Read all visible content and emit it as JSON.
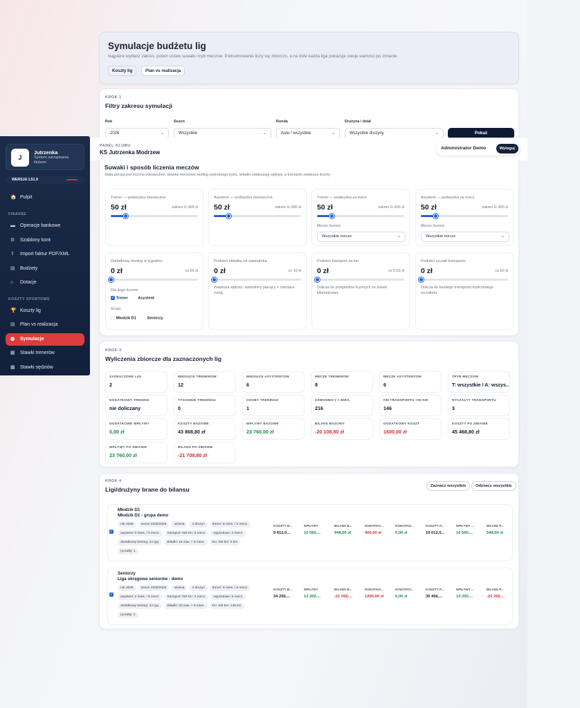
{
  "header": {
    "title": "Symulacje budżetu lig",
    "subtitle": "Najpierw wybierz zakres, potem ustaw suwaki i tryb meczów. Podsumowanie liczy się zbiorczo, a na dole każda liga pokazuje swoje wartości po zmianie.",
    "tabs": [
      "Koszty lig",
      "Plan vs realizacja"
    ]
  },
  "step1": {
    "kicker": "KROK 1",
    "title": "Filtry zakresu symulacji",
    "filters": [
      {
        "label": "Rok",
        "value": "2026"
      },
      {
        "label": "Sezon",
        "value": "Wszystkie"
      },
      {
        "label": "Runda",
        "value": "Auto / wszystkie"
      },
      {
        "label": "Drużyna / dział",
        "value": "Wszystkie drużyny"
      }
    ],
    "show_button": "Pokaż"
  },
  "topbar": {
    "kicker": "PANEL KLUBU",
    "club": "KS Jutrzenka Modrzew",
    "user": "Administrator Demo",
    "logout": "Wyloguj"
  },
  "sidebar": {
    "logo_letter": "J",
    "app_name": "Jutrzenka",
    "app_desc": "System zarządzania klubem",
    "version": "WERSJA 1.51.9",
    "items_top": [
      {
        "label": "Pulpit",
        "icon": "🏠"
      }
    ],
    "section_finance": "FINANSE",
    "finance": [
      {
        "label": "Operacje bankowe",
        "icon": "▬"
      },
      {
        "label": "Szablony kont",
        "icon": "⚙"
      },
      {
        "label": "Import faktur PDF/XML",
        "icon": "⇪"
      },
      {
        "label": "Budżety",
        "icon": "▤"
      },
      {
        "label": "Dotacje",
        "icon": "⌂"
      }
    ],
    "section_sport": "KOSZTY SPORTOWE",
    "sport": [
      {
        "label": "Koszty lig",
        "icon": "🏆"
      },
      {
        "label": "Plan vs realizacja",
        "icon": "▤"
      },
      {
        "label": "Symulacje",
        "icon": "◍"
      },
      {
        "label": "Stawki trenerów",
        "icon": "▦"
      },
      {
        "label": "Stawki sędziów",
        "icon": "▩"
      }
    ]
  },
  "step2": {
    "title": "Suwaki i sposób liczenia meczów",
    "subtitle": "Stała pensja jest liczona miesięcznie, stawka meczowa według wybranego trybu, składki zwiększają wpływy, a transport zwiększa koszty.",
    "sliders": [
      {
        "label": "Trener — podwyżka miesięczna",
        "value": "50 zł",
        "range": "zakres 0–300 zł",
        "level": 0.1667
      },
      {
        "label": "Asystent — podwyżka miesięczna",
        "value": "50 zł",
        "range": "zakres 0–300 zł",
        "level": 0.1667
      },
      {
        "label": "Trener — podwyżka za mecz",
        "value": "50 zł",
        "range": "zakres 0–300 zł",
        "level": 0.1667,
        "select_label": "Mecze liczone",
        "select_value": "Wszystkie mecze"
      },
      {
        "label": "Asystent — podwyżka za mecz",
        "value": "50 zł",
        "range": "zakres 0–300 zł",
        "level": 0.1667,
        "select_label": "Mecze liczone",
        "select_value": "Wszystkie mecze"
      },
      {
        "label": "Dodatkowy trening w tygodniu",
        "value": "0 zł",
        "range": "co 50 zł",
        "level": 0
      },
      {
        "label": "Podnieś składkę od zawodnika",
        "value": "0 zł",
        "range": "co 10 zł",
        "level": 0,
        "hint": "Zwiększa wpływy: zawodnicy płacący × miesiące rundy."
      },
      {
        "label": "Podnieś transport za km",
        "value": "0 zł",
        "range": "co 0,50 zł",
        "level": 0,
        "hint": "Dolicza do przejazdów liczonych ze stawki kilometrowej."
      },
      {
        "label": "Podnieś ryczałt transportu",
        "value": "0 zł",
        "range": "co 50 zł",
        "level": 0,
        "hint": "Dolicza do każdego transportu rozliczanego ryczałtem."
      }
    ],
    "for_whom_label": "Dla kogo liczone",
    "for_whom": [
      {
        "label": "Trener",
        "checked": true
      },
      {
        "label": "Asystent",
        "checked": false
      }
    ],
    "groups_label": "Grupy",
    "groups": [
      {
        "label": "Młodzik D1",
        "checked": false
      },
      {
        "label": "Seniorzy",
        "checked": false
      }
    ]
  },
  "step3": {
    "kicker": "KROK 3",
    "title": "Wyliczenia zbiorcze dla zaznaczonych lig",
    "metrics": [
      {
        "label": "ZAZNACZONE LIGI",
        "value": "2",
        "tone": ""
      },
      {
        "label": "MIESIĄCE TRENERÓW",
        "value": "12",
        "tone": ""
      },
      {
        "label": "MIESIĄCE ASYSTENTÓW",
        "value": "6",
        "tone": ""
      },
      {
        "label": "MECZE TRENERÓW",
        "value": "8",
        "tone": ""
      },
      {
        "label": "MECZE ASYSTENTÓW",
        "value": "6",
        "tone": ""
      },
      {
        "label": "TRYB MECZÓW",
        "value": "T: wszystkie / A: wszys...",
        "tone": ""
      },
      {
        "label": "DODATKOWY TRENING",
        "value": "nie doliczany",
        "tone": ""
      },
      {
        "label": "TYGODNIE TRENINGU",
        "value": "0",
        "tone": ""
      },
      {
        "label": "OSOBY TRENINGU",
        "value": "1",
        "tone": ""
      },
      {
        "label": "ZAWODNICY × MIES.",
        "value": "216",
        "tone": ""
      },
      {
        "label": "KM TRANSPORTU >50 KM",
        "value": "146",
        "tone": ""
      },
      {
        "label": "RYCZAŁTY TRANSPORTU",
        "value": "3",
        "tone": ""
      },
      {
        "label": "DODATKOWE WPŁYWY",
        "value": "0,00 zł",
        "tone": "green"
      },
      {
        "label": "KOSZTY BAZOWE",
        "value": "43 868,80 zł",
        "tone": ""
      },
      {
        "label": "WPŁYWY BAZOWE",
        "value": "23 760,00 zł",
        "tone": "green"
      },
      {
        "label": "BILANS BAZOWY",
        "value": "-20 108,80 zł",
        "tone": "red"
      },
      {
        "label": "DODATKOWY KOSZT",
        "value": "1600,00 zł",
        "tone": "red"
      },
      {
        "label": "KOSZTY PO ZMIANIE",
        "value": "45 468,80 zł",
        "tone": ""
      },
      {
        "label": "WPŁYWY PO ZMIANIE",
        "value": "23 760,00 zł",
        "tone": "green"
      },
      {
        "label": "BILANS PO ZMIANIE",
        "value": "-21 708,80 zł",
        "tone": "red"
      }
    ]
  },
  "step4": {
    "kicker": "KROK 4",
    "title": "Ligi/drużyny brane do bilansu",
    "select_all": "Zaznacz wszystkie",
    "deselect_all": "Odznacz wszystkie",
    "leagues": [
      {
        "team": "Młodzik D1",
        "league": "Młodzik D1 - grupa demo",
        "tags": [
          [
            "rok 2026",
            "sezon 2025/2026",
            "wiosna",
            "3 drużyn",
            "trener: 6 mies. / 2 mecz."
          ],
          [
            "asystent: 0 mies. / 0 mecz.",
            "transport >50 km: 0 mecz.",
            "wyjazdowe: 2 mecz."
          ],
          [
            "dodatkowy trening: 24 tyg.",
            "składki: 16 zaw. × 6 mies.",
            "km >50 km: 0 km"
          ],
          [
            "ryczałty: 1"
          ]
        ],
        "values": [
          {
            "label": "KOSZTY B...",
            "value": "9 612,0...",
            "tone": ""
          },
          {
            "label": "WPŁYWY",
            "value": "10 560,...",
            "tone": "green"
          },
          {
            "label": "BILANS B...",
            "value": "948,00 zł",
            "tone": "green"
          },
          {
            "label": "DODATKO...",
            "value": "400,00 zł",
            "tone": "red"
          },
          {
            "label": "DODATKO...",
            "value": "0,00 zł",
            "tone": "green"
          },
          {
            "label": "KOSZTY P...",
            "value": "10 012,0...",
            "tone": ""
          },
          {
            "label": "WPŁYWY ...",
            "value": "10 560,...",
            "tone": "green"
          },
          {
            "label": "BILANS P...",
            "value": "548,00 zł",
            "tone": "green"
          }
        ]
      },
      {
        "team": "Seniorzy",
        "league": "Liga okręgowa seniorów - demo",
        "tags": [
          [
            "rok 2026",
            "sezon 2025/2026",
            "wiosna",
            "4 drużyn",
            "trener: 6 mies. / 6 mecz."
          ],
          [
            "asystent: 6 mies. / 6 mecz.",
            "transport >50 km: 2 mecz.",
            "wyjazdowe: 6 mecz."
          ],
          [
            "dodatkowy trening: 24 tyg.",
            "składki: 20 zaw. × 6 mies.",
            "km >50 km: 146 km"
          ],
          [
            "ryczałty: 2"
          ]
        ],
        "values": [
          {
            "label": "KOSZTY B...",
            "value": "34 256,...",
            "tone": ""
          },
          {
            "label": "WPŁYWY",
            "value": "13 200,...",
            "tone": "green"
          },
          {
            "label": "BILANS B...",
            "value": "-21 056,...",
            "tone": "red"
          },
          {
            "label": "DODATKO...",
            "value": "1200,00 zł",
            "tone": "red"
          },
          {
            "label": "DODATKO...",
            "value": "0,00 zł",
            "tone": "green"
          },
          {
            "label": "KOSZTY P...",
            "value": "35 456,...",
            "tone": ""
          },
          {
            "label": "WPŁYWY ...",
            "value": "13 200,...",
            "tone": "green"
          },
          {
            "label": "BILANS P...",
            "value": "-22 256,...",
            "tone": "red"
          }
        ]
      }
    ]
  }
}
